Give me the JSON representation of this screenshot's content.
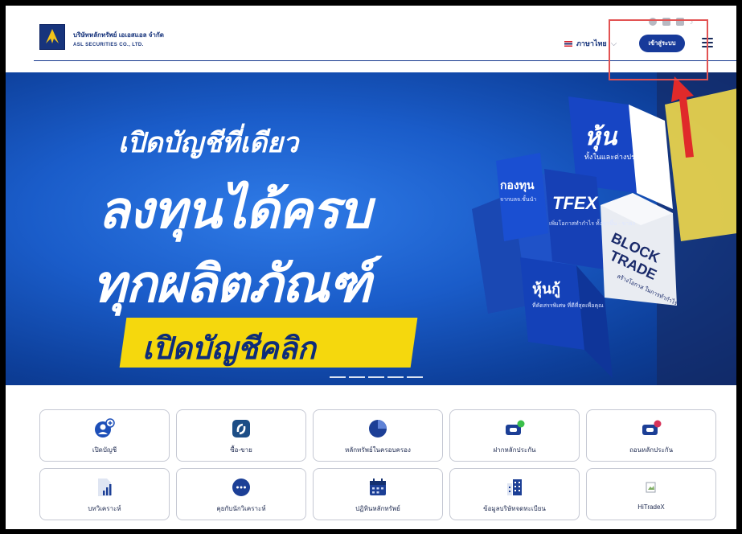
{
  "header": {
    "company_th": "บริษัทหลักทรัพย์ เอเอสแอล จำกัด",
    "company_en": "ASL SECURITIES CO., LTD.",
    "language": "ภาษาไทย",
    "login": "เข้าสู่ระบบ",
    "socials": [
      "facebook-icon",
      "line-icon",
      "youtube-icon",
      "tiktok-icon"
    ]
  },
  "banner": {
    "line1": "เปิดบัญชีที่เดียว",
    "line2": "ลงทุนได้ครบ",
    "line3": "ทุกผลิตภัณฑ์",
    "cta": "เปิดบัญชีคลิก",
    "cubes": {
      "stock_title": "หุ้น",
      "stock_sub": "ทั้งในและต่างประเทศ",
      "fund_title": "กองทุน",
      "fund_sub": "จากบลจ.ชั้นนำ",
      "tfex_title": "TFEX",
      "tfex_sub": "เพิ่มโอกาสทำกำไร ทั้งขาขึ้น - ขาลง",
      "block_title1": "BLOCK",
      "block_title2": "TRADE",
      "block_sub": "สร้างโอกาส ในการทำกำไร",
      "bond_title": "หุ้นกู้",
      "bond_sub": "ที่คัดสรรพิเศษ ที่ดีที่สุดเพื่อคุณ"
    }
  },
  "colors": {
    "brand": "#17347c",
    "accent_yellow": "#f5d80d",
    "banner_blue": "#1a5cc9",
    "highlight": "#e25252"
  },
  "tiles": [
    {
      "label": "เปิดบัญชี",
      "icon": "add-user-icon"
    },
    {
      "label": "ซื้อ-ขาย",
      "icon": "trade-icon"
    },
    {
      "label": "หลักทรัพย์ในครอบครอง",
      "icon": "pie-chart-icon"
    },
    {
      "label": "ฝากหลักประกัน",
      "icon": "deposit-icon"
    },
    {
      "label": "ถอนหลักประกัน",
      "icon": "withdraw-icon"
    },
    {
      "label": "บทวิเคราะห์",
      "icon": "analysis-icon"
    },
    {
      "label": "คุยกับนักวิเคราะห์",
      "icon": "chat-icon"
    },
    {
      "label": "ปฏิทินหลักทรัพย์",
      "icon": "calendar-icon"
    },
    {
      "label": "ข้อมูลบริษัทจดทะเบียน",
      "icon": "company-info-icon"
    },
    {
      "label": "HiTradeX",
      "icon": "broken-image-icon"
    }
  ]
}
